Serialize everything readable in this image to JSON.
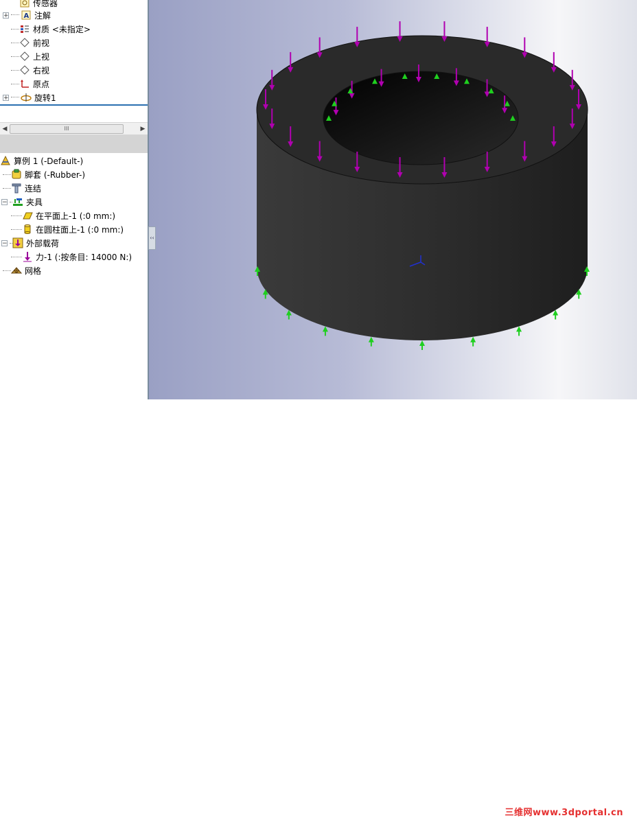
{
  "feature_tree": {
    "items": [
      {
        "label": "传感器",
        "icon": "sensor-icon"
      },
      {
        "label": "注解",
        "icon": "annotation-icon"
      },
      {
        "label": "材质 <未指定>",
        "icon": "material-icon"
      },
      {
        "label": "前视",
        "icon": "plane-icon"
      },
      {
        "label": "上视",
        "icon": "plane-icon"
      },
      {
        "label": "右视",
        "icon": "plane-icon"
      },
      {
        "label": "原点",
        "icon": "origin-icon"
      },
      {
        "label": "旋转1",
        "icon": "revolve-icon"
      }
    ]
  },
  "scrollbar": {
    "thumb_grip": "III"
  },
  "study_tree": {
    "root": "算例 1 (-Default-)",
    "part": "脚套 (-Rubber-)",
    "connections": "连结",
    "fixtures": "夹具",
    "fixture_items": [
      "在平面上-1 (:0 mm:)",
      "在圆柱面上-1 (:0 mm:)"
    ],
    "external_loads": "外部载荷",
    "load_items": [
      "力-1 (:按条目: 14000 N:)"
    ],
    "mesh": "网格"
  },
  "collapse_tab": {
    "glyphs": "‹‹"
  },
  "watermark": "三维网www.3dportal.cn",
  "colors": {
    "load_arrow": "#b000b0",
    "fixture_arrow": "#1fcf1f",
    "part_body": "#2b2b2b",
    "tree_accent": "#2a6fb0"
  }
}
